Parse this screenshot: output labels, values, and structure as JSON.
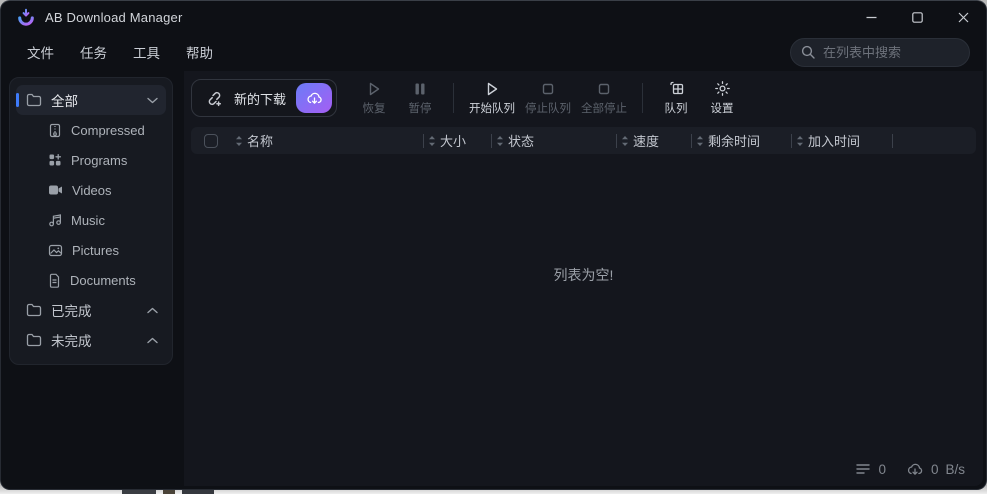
{
  "window": {
    "title": "AB Download Manager"
  },
  "menu": {
    "items": [
      {
        "label": "文件"
      },
      {
        "label": "任务"
      },
      {
        "label": "工具"
      },
      {
        "label": "帮助"
      }
    ]
  },
  "search": {
    "placeholder": "在列表中搜索",
    "value": ""
  },
  "sidebar": {
    "all": {
      "label": "全部",
      "selected": true,
      "icon": "folder-icon"
    },
    "categories": [
      {
        "label": "Compressed",
        "icon": "zip-file-icon"
      },
      {
        "label": "Programs",
        "icon": "apps-grid-icon"
      },
      {
        "label": "Videos",
        "icon": "video-camera-icon"
      },
      {
        "label": "Music",
        "icon": "music-note-icon"
      },
      {
        "label": "Pictures",
        "icon": "picture-icon"
      },
      {
        "label": "Documents",
        "icon": "document-icon"
      }
    ],
    "sections": [
      {
        "label": "已完成",
        "icon": "folder-icon",
        "chevron": "up"
      },
      {
        "label": "未完成",
        "icon": "folder-icon",
        "chevron": "up"
      }
    ]
  },
  "toolbar": {
    "new_download": {
      "label": "新的下载",
      "icon": "link-plus-icon"
    },
    "quick_download": {
      "icon": "cloud-download-icon"
    },
    "buttons": [
      {
        "label": "恢复",
        "icon": "play-icon",
        "enabled": false
      },
      {
        "label": "暂停",
        "icon": "pause-icon",
        "enabled": false
      },
      {
        "label": "开始队列",
        "icon": "play-icon",
        "enabled": true
      },
      {
        "label": "停止队列",
        "icon": "stop-square-icon",
        "enabled": false
      },
      {
        "label": "全部停止",
        "icon": "stop-square-icon",
        "enabled": false
      },
      {
        "label": "队列",
        "icon": "queue-grid-icon",
        "enabled": true
      },
      {
        "label": "设置",
        "icon": "gear-icon",
        "enabled": true
      }
    ]
  },
  "table": {
    "columns": [
      {
        "label": "名称"
      },
      {
        "label": "大小"
      },
      {
        "label": "状态"
      },
      {
        "label": "速度"
      },
      {
        "label": "剩余时间"
      },
      {
        "label": "加入时间"
      }
    ],
    "empty_message": "列表为空!"
  },
  "statusbar": {
    "active_downloads": "0",
    "speed_value": "0",
    "speed_unit": "B/s"
  },
  "colors": {
    "accent_blue": "#3e7bfa",
    "gradient_start": "#6b7cf7",
    "gradient_end": "#a55ef3",
    "window_bg": "#0e1015",
    "panel_bg": "#171a21",
    "header_bg": "#1b1e26"
  }
}
